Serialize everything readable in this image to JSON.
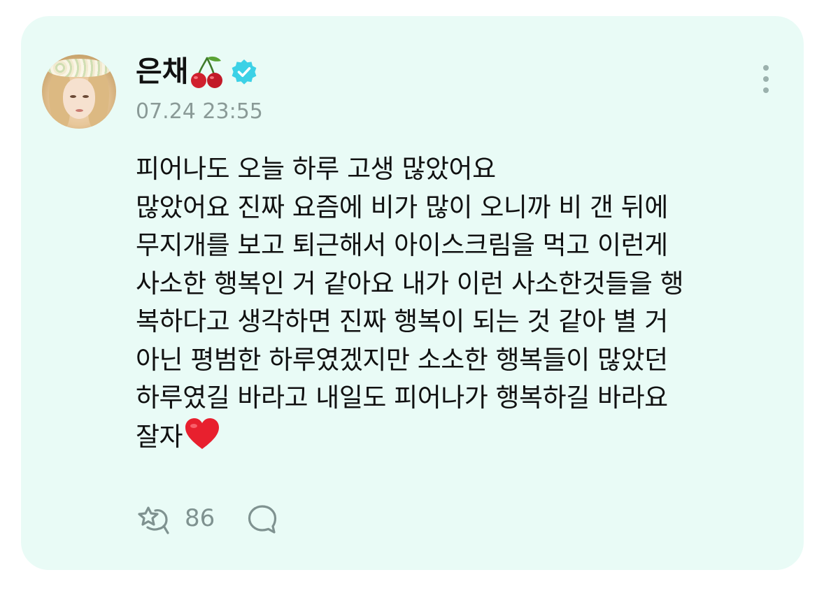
{
  "post": {
    "author": {
      "name": "은채",
      "name_emoji": "cherry-icon",
      "verified": true,
      "verified_icon": "verified-badge-icon",
      "verified_color": "#3cd1e6"
    },
    "timestamp": "07.24 23:55",
    "body_lines": [
      "피어나도 오늘 하루 고생 많았어요",
      "많았어요 진짜 요즘에 비가 많이 오니까 비 갠 뒤에",
      "무지개를 보고 퇴근해서 아이스크림을 먹고 이런게",
      "사소한 행복인 거 같아요 내가 이런 사소한것들을 행",
      "복하다고 생각하면 진짜 행복이 되는 것 같아 별 거",
      "아닌 평범한 하루였겠지만 소소한 행복들이 많았던",
      "하루였길 바라고 내일도 피어나가 행복하길 바라요",
      "잘자"
    ],
    "body_end_emoji": "red-heart-icon",
    "actions": {
      "repost_icon": "repost-icon",
      "repost_count": "86",
      "comment_icon": "comment-icon"
    },
    "menu_icon": "more-vertical-icon",
    "colors": {
      "card_background": "#e9fbf6",
      "text": "#111111",
      "muted": "#8a9a97"
    }
  }
}
